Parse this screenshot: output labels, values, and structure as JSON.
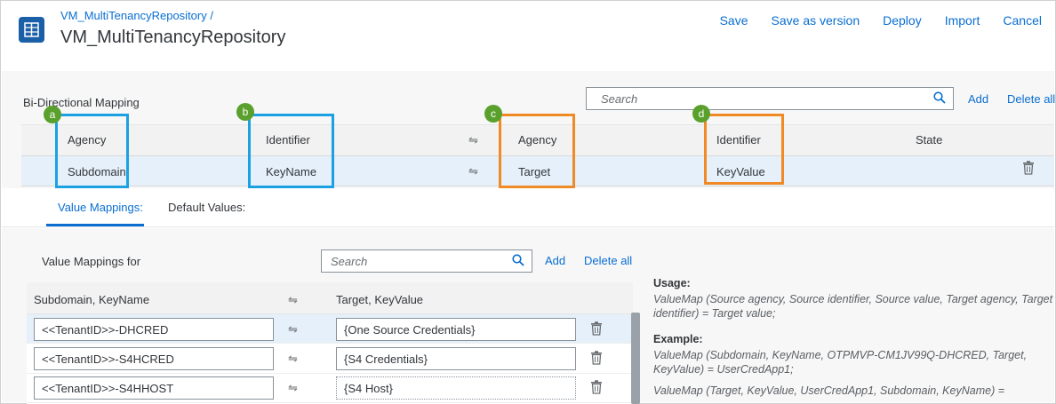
{
  "header": {
    "breadcrumb": "VM_MultiTenancyRepository /",
    "title": "VM_MultiTenancyRepository",
    "actions": [
      "Save",
      "Save as version",
      "Deploy",
      "Import",
      "Cancel"
    ]
  },
  "mapping": {
    "section_title": "Bi-Directional Mapping",
    "search_placeholder": "Search",
    "add_label": "Add",
    "delete_all_label": "Delete all",
    "header_row": {
      "agency": "Agency",
      "identifier": "Identifier",
      "target_agency": "Agency",
      "target_identifier": "Identifier",
      "state": "State"
    },
    "data_row": {
      "agency": "Subdomain",
      "identifier": "KeyName",
      "target_agency": "Target",
      "target_identifier": "KeyValue"
    },
    "badges": [
      "a",
      "b",
      "c",
      "d"
    ]
  },
  "tabs": {
    "value_mappings": "Value Mappings:",
    "default_values": "Default Values:"
  },
  "value_mappings": {
    "title": "Value Mappings for",
    "search_placeholder": "Search",
    "add_label": "Add",
    "delete_all_label": "Delete all",
    "col_source": "Subdomain, KeyName",
    "col_target": "Target, KeyValue",
    "rows": [
      {
        "source": "<<TenantID>>-DHCRED",
        "target": "{One Source Credentials}"
      },
      {
        "source": "<<TenantID>>-S4HCRED",
        "target": "{S4 Credentials}"
      },
      {
        "source": "<<TenantID>>-S4HHOST",
        "target": "{S4 Host}"
      }
    ]
  },
  "help": {
    "usage_label": "Usage:",
    "usage_text": "ValueMap (Source agency, Source identifier, Source value, Target agency, Target identifier) = Target value;",
    "example_label": "Example:",
    "example_text": "ValueMap (Subdomain, KeyName, OTPMVP-CM1JV99Q-DHCRED, Target, KeyValue) = UserCredApp1;",
    "example_text2": "ValueMap (Target, KeyValue, UserCredApp1, Subdomain, KeyName) ="
  },
  "colors": {
    "accent": "#0a6ed1",
    "box_blue": "#1ba1e2",
    "box_orange": "#f08a24",
    "badge_green": "#5aa02c"
  }
}
